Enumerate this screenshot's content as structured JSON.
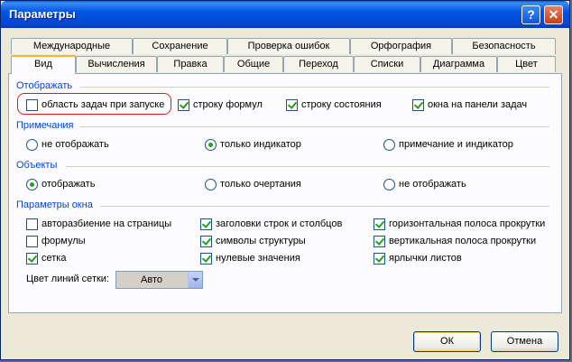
{
  "window": {
    "title": "Параметры",
    "help_label": "?",
    "close_label": "✕"
  },
  "tabs_row1": [
    "Международные",
    "Сохранение",
    "Проверка ошибок",
    "Орфография",
    "Безопасность"
  ],
  "tabs_row2": [
    "Вид",
    "Вычисления",
    "Правка",
    "Общие",
    "Переход",
    "Списки",
    "Диаграмма",
    "Цвет"
  ],
  "active_tab": "Вид",
  "show": {
    "heading": "Отображать",
    "items": [
      {
        "label": "область задач при запуске",
        "checked": false
      },
      {
        "label": "строку формул",
        "checked": true
      },
      {
        "label": "строку состояния",
        "checked": true
      },
      {
        "label": "окна на панели задач",
        "checked": true
      }
    ]
  },
  "comments": {
    "heading": "Примечания",
    "options": [
      {
        "label": "не отображать",
        "selected": false
      },
      {
        "label": "только индикатор",
        "selected": true
      },
      {
        "label": "примечание и индикатор",
        "selected": false
      }
    ]
  },
  "objects": {
    "heading": "Объекты",
    "options": [
      {
        "label": "отображать",
        "selected": true
      },
      {
        "label": "только очертания",
        "selected": false
      },
      {
        "label": "не отображать",
        "selected": false
      }
    ]
  },
  "window_options": {
    "heading": "Параметры окна",
    "items": [
      {
        "label": "авторазбиение на страницы",
        "checked": false
      },
      {
        "label": "заголовки строк и столбцов",
        "checked": true
      },
      {
        "label": "горизонтальная полоса прокрутки",
        "checked": true
      },
      {
        "label": "формулы",
        "checked": false
      },
      {
        "label": "символы структуры",
        "checked": true
      },
      {
        "label": "вертикальная полоса прокрутки",
        "checked": true
      },
      {
        "label": "сетка",
        "checked": true
      },
      {
        "label": "нулевые значения",
        "checked": true
      },
      {
        "label": "ярлычки листов",
        "checked": true
      }
    ],
    "grid_color_label": "Цвет линий сетки:",
    "grid_color_value": "Авто"
  },
  "buttons": {
    "ok": "ОК",
    "cancel": "Отмена"
  },
  "colors": {
    "title_bar": "#0055e5",
    "group_heading": "#0046d5",
    "highlight": "#d91c1c",
    "check": "#21a121"
  }
}
